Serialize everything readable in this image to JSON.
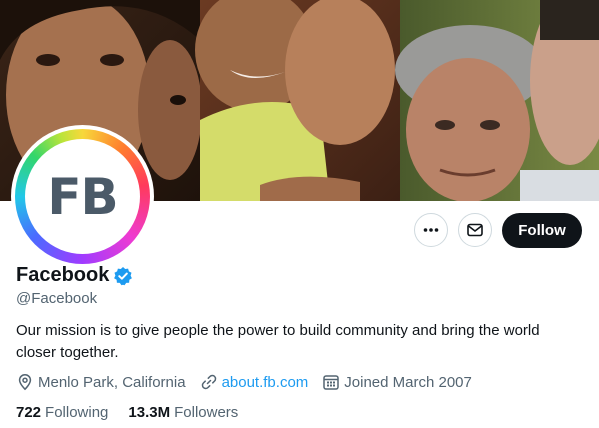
{
  "profile": {
    "avatar_text": "FB",
    "display_name": "Facebook",
    "handle": "@Facebook",
    "bio": "Our mission is to give people the power to build community and bring the world closer together.",
    "location": "Menlo Park, California",
    "website": "about.fb.com",
    "joined": "Joined March 2007",
    "following_count": "722",
    "following_label": "Following",
    "followers_count": "13.3M",
    "followers_label": "Followers"
  },
  "actions": {
    "follow_label": "Follow",
    "more_icon": "more-icon",
    "message_icon": "envelope-icon"
  },
  "colors": {
    "accent": "#1d9bf0",
    "follow_button": "#0f1419",
    "secondary_text": "#536471"
  }
}
